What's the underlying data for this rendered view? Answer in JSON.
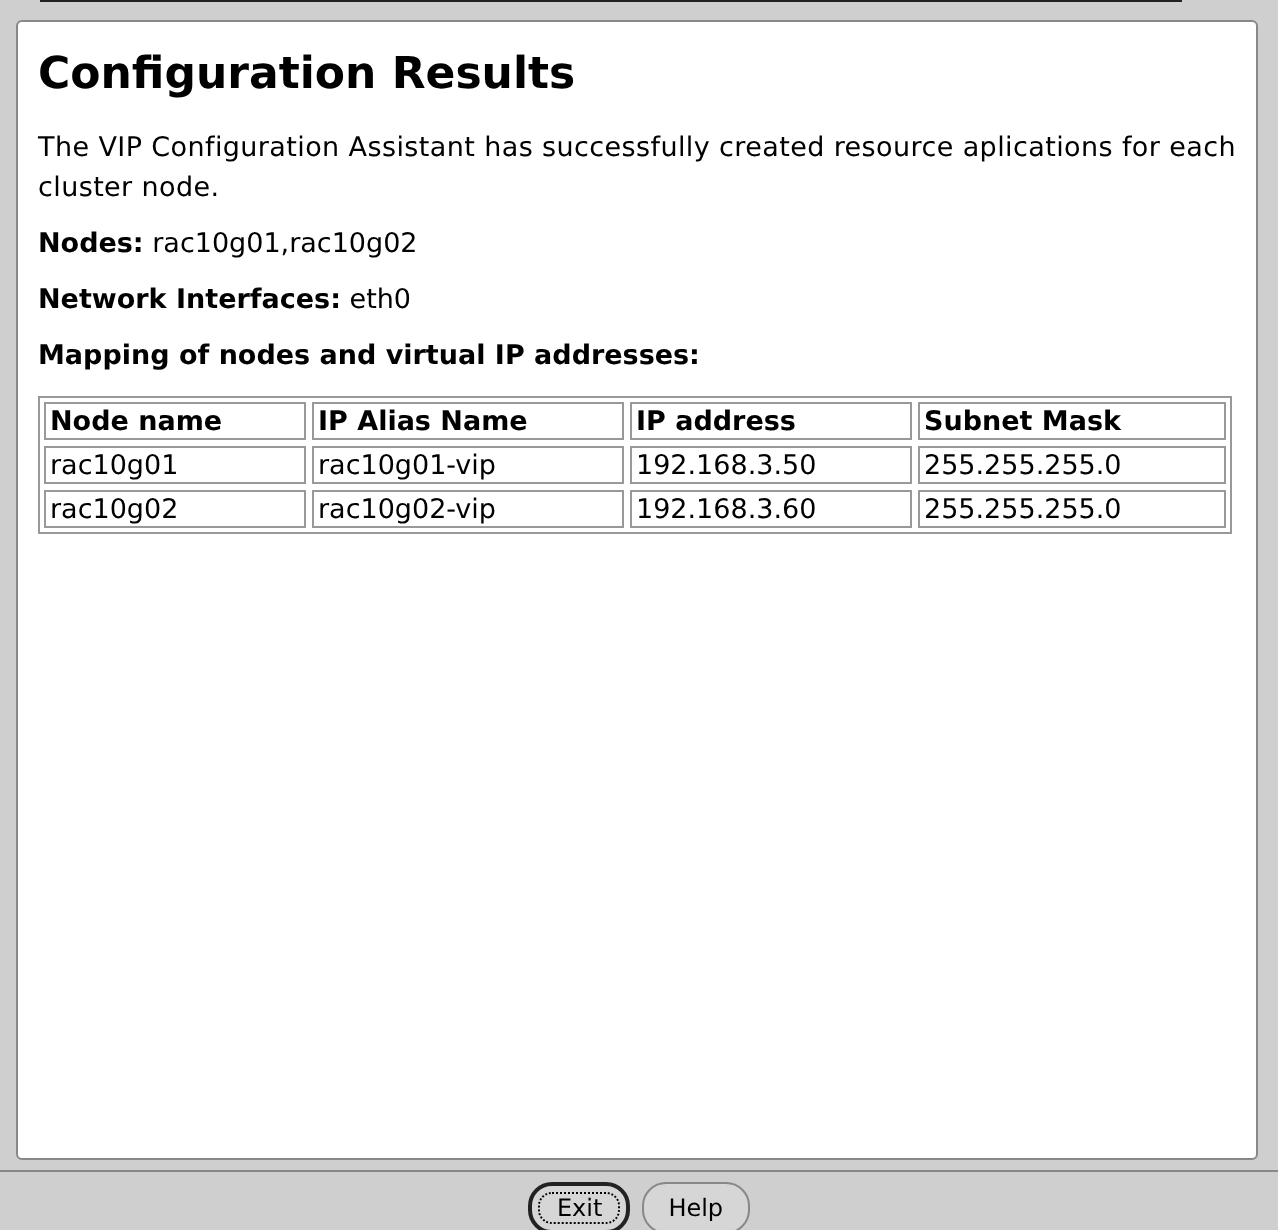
{
  "heading": "Configuration Results",
  "intro": "The VIP Configuration Assistant has successfully created resource aplications for each cluster node.",
  "fields": [
    {
      "label": "Nodes:",
      "value": "rac10g01,rac10g02"
    },
    {
      "label": "Network Interfaces:",
      "value": "eth0"
    }
  ],
  "mapping_title": "Mapping of nodes and virtual IP addresses:",
  "table": {
    "columns": [
      "Node name",
      "IP Alias Name",
      "IP address",
      "Subnet Mask"
    ],
    "rows": [
      [
        "rac10g01",
        "rac10g01-vip",
        "192.168.3.50",
        "255.255.255.0"
      ],
      [
        "rac10g02",
        "rac10g02-vip",
        "192.168.3.60",
        "255.255.255.0"
      ]
    ]
  },
  "buttons": [
    {
      "label": "Exit",
      "focused": true
    },
    {
      "label": "Help",
      "focused": false
    }
  ]
}
